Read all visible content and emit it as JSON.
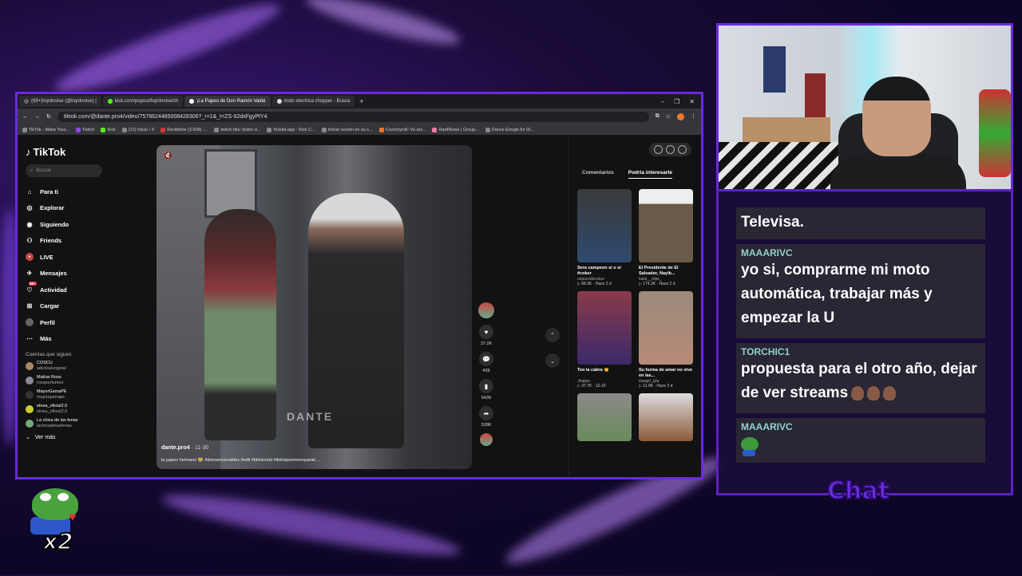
{
  "browser": {
    "tabs": [
      {
        "label": "(89+)hqrdnoise (@hqrdnoise) |",
        "active": false
      },
      {
        "label": "kick.com/popout/hqrdnoise/ch",
        "active": false
      },
      {
        "label": "¡La Papeo de Don Ramón Valdé",
        "active": true
      },
      {
        "label": "moto electrica chopper - Busca",
        "active": false
      }
    ],
    "url": "tiktok.com/@dante.pro4/video/7578624485008428306?_r=1&_t=ZS-92dxFgyPtY4",
    "bookmarks": [
      "TikTok - Make Your...",
      "Twitch",
      "Kick",
      "(21) Inicio / X",
      "Recibidos (3.608) -...",
      "twitch bits: botón d...",
      "Kicklet.app - Kick C...",
      "Iniciar sesión en su c...",
      "Crunchyroll: Ve ani...",
      "HqrdNoise | Group...",
      "Dance Emojis for Di..."
    ]
  },
  "tiktok": {
    "logo": "TikTok",
    "search_placeholder": "Buscar",
    "nav": [
      {
        "label": "Para ti",
        "icon": "home-icon"
      },
      {
        "label": "Explorar",
        "icon": "compass-icon"
      },
      {
        "label": "Siguiendo",
        "icon": "following-icon"
      },
      {
        "label": "Friends",
        "icon": "friends-icon"
      },
      {
        "label": "LIVE",
        "icon": "live-icon"
      },
      {
        "label": "Mensajes",
        "icon": "message-icon"
      },
      {
        "label": "Actividad",
        "icon": "activity-icon",
        "badge": "99+"
      },
      {
        "label": "Cargar",
        "icon": "upload-icon"
      },
      {
        "label": "Perfil",
        "icon": "profile-icon"
      },
      {
        "label": "Más",
        "icon": "more-icon"
      }
    ],
    "following_title": "Cuentas que sigues",
    "following": [
      {
        "name": "COSCU",
        "handle": "adictoalvogetal"
      },
      {
        "name": "Matías Ross",
        "handle": "rossperfumes"
      },
      {
        "name": "MayorGamaPE",
        "handle": "mayorgamape"
      },
      {
        "name": "elnea_oficial2.0",
        "handle": "elnea_oficial2.0"
      },
      {
        "name": "La chica de las ferias",
        "handle": "lachicadelasferias"
      }
    ],
    "see_more": "Ver más",
    "video": {
      "watermark": "DANTE",
      "author": "dante.pro4",
      "date": "· 11-30",
      "caption": "la papeo hermano 😹 #donramonvaldes #edit #tiktokviral #tiktokponmeenparati ..."
    },
    "actions": {
      "likes": "37.2K",
      "comments": "439",
      "saves": "6439",
      "shares": "5286"
    },
    "panel_tabs": [
      "Comentarios",
      "Podría interesarte"
    ],
    "cards": [
      {
        "title": "Sera campeon si o si #coker",
        "user": "unpocodecoker",
        "views": "68.3K",
        "age": "Hace 2 d",
        "color": "#2e4a6e"
      },
      {
        "title": "El Presidente de El Salvador, Nayib...",
        "user": "lasla__clips_",
        "views": "174.2K",
        "age": "Hace 2 d",
        "color": "#6a5a48"
      },
      {
        "title": "Teo la cabra 👏",
        "user": ".thajiax",
        "views": "37.7K",
        "age": "12-10",
        "color": "#8a3a4a"
      },
      {
        "title": "Su forma de amar no vive en las...",
        "user": "stargirl_lyla",
        "views": "11.9K",
        "age": "Hace 2 d",
        "color": "#b88a78"
      },
      {
        "title": "",
        "user": "",
        "views": "",
        "age": "",
        "color": "#6a8a5a"
      },
      {
        "title": "",
        "user": "",
        "views": "",
        "age": "",
        "color": "#8a5a38"
      }
    ]
  },
  "chat": {
    "messages": [
      {
        "user": "",
        "text": "Televisa."
      },
      {
        "user": "MAAARIVC",
        "text": "yo si, comprarme mi moto automática, trabajar más y empezar la U"
      },
      {
        "user": "TORCHIC1",
        "text": "propuesta para el otro año, dejar de ver streams"
      },
      {
        "user": "MAAARIVC",
        "text": ""
      }
    ],
    "label": "Chat"
  },
  "overlay": {
    "badge_text": "x2"
  }
}
